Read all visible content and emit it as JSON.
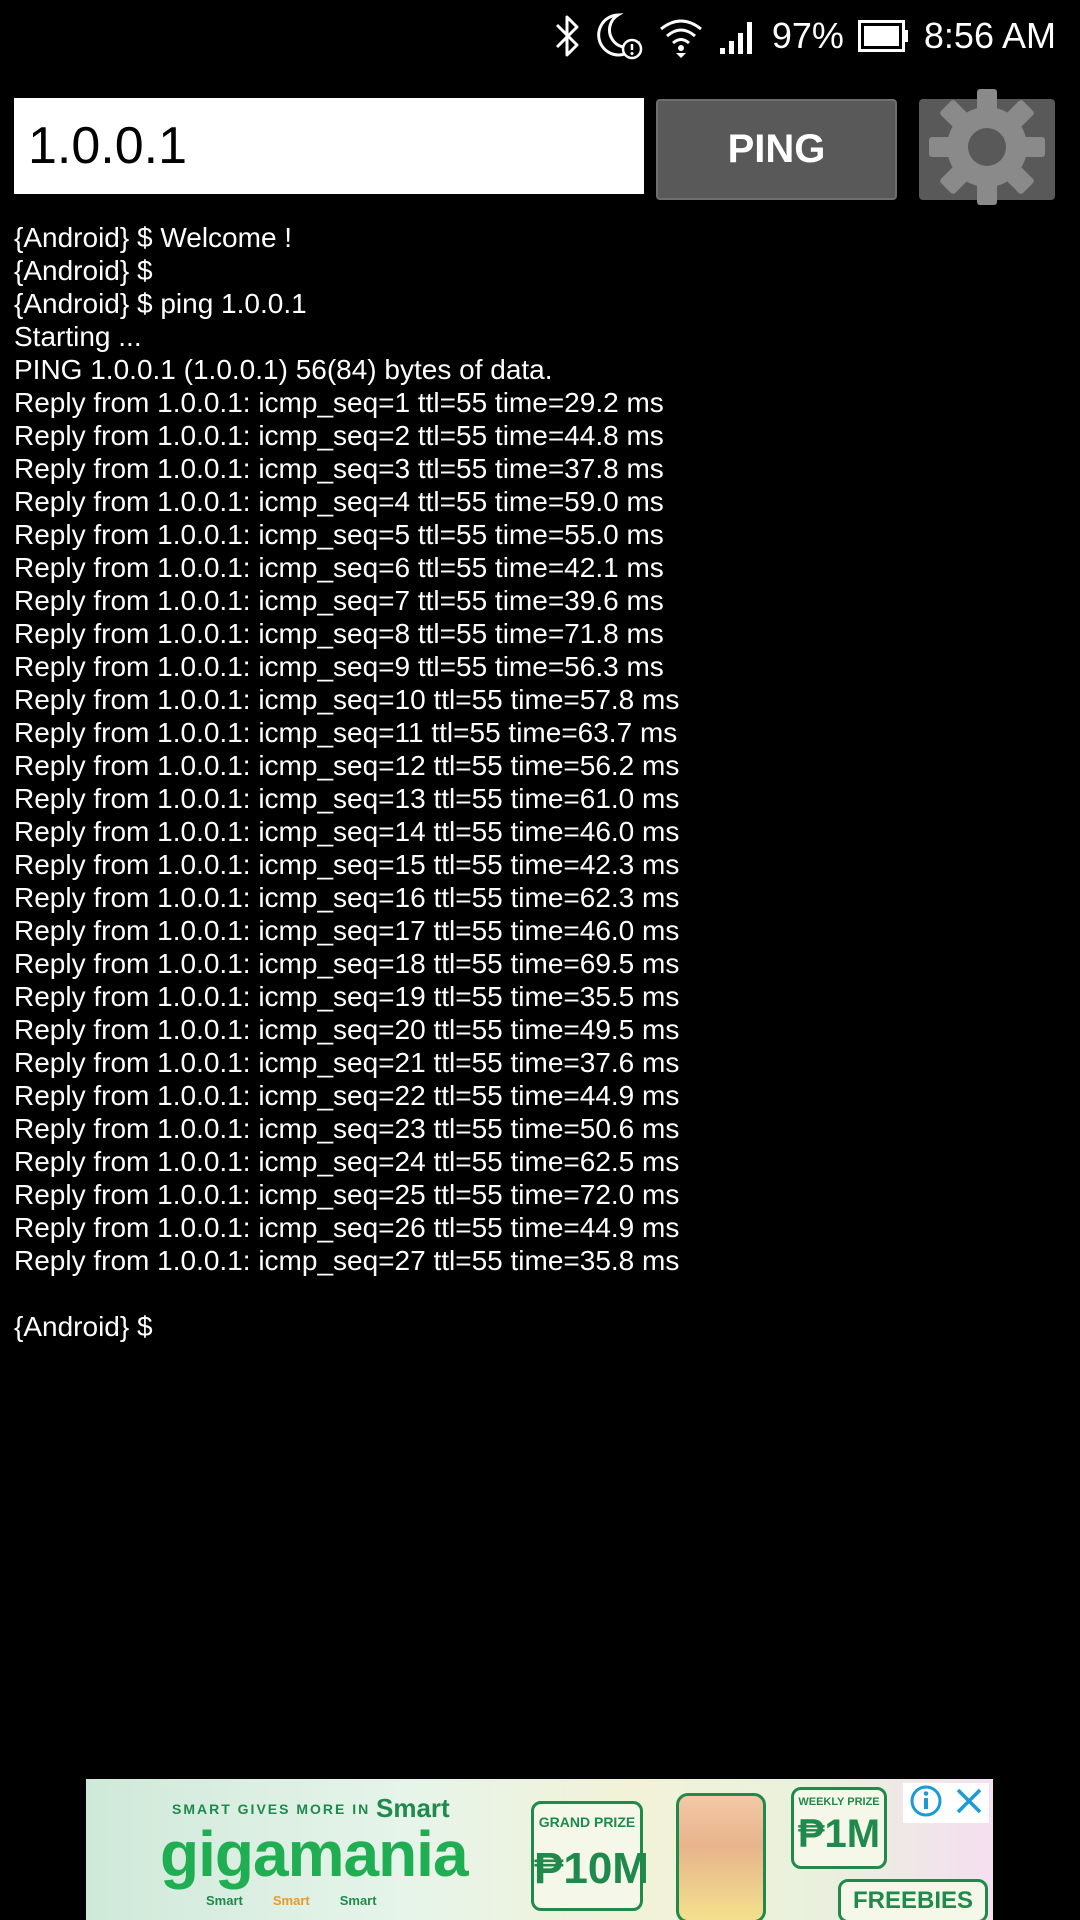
{
  "status_bar": {
    "battery_percent": "97%",
    "time": "8:56 AM",
    "icons": [
      "bluetooth-icon",
      "do-not-disturb-icon",
      "wifi-icon",
      "cellular-signal-icon",
      "battery-icon"
    ]
  },
  "toolbar": {
    "host_value": "1.0.0.1",
    "ping_label": "PING",
    "settings_icon": "gear-icon"
  },
  "console": {
    "lines": [
      "{Android} $ Welcome !",
      "{Android} $",
      "{Android} $ ping 1.0.0.1",
      "Starting ...",
      "PING 1.0.0.1 (1.0.0.1) 56(84) bytes of data.",
      "Reply from 1.0.0.1: icmp_seq=1 ttl=55 time=29.2 ms",
      "Reply from 1.0.0.1: icmp_seq=2 ttl=55 time=44.8 ms",
      "Reply from 1.0.0.1: icmp_seq=3 ttl=55 time=37.8 ms",
      "Reply from 1.0.0.1: icmp_seq=4 ttl=55 time=59.0 ms",
      "Reply from 1.0.0.1: icmp_seq=5 ttl=55 time=55.0 ms",
      "Reply from 1.0.0.1: icmp_seq=6 ttl=55 time=42.1 ms",
      "Reply from 1.0.0.1: icmp_seq=7 ttl=55 time=39.6 ms",
      "Reply from 1.0.0.1: icmp_seq=8 ttl=55 time=71.8 ms",
      "Reply from 1.0.0.1: icmp_seq=9 ttl=55 time=56.3 ms",
      "Reply from 1.0.0.1: icmp_seq=10 ttl=55 time=57.8 ms",
      "Reply from 1.0.0.1: icmp_seq=11 ttl=55 time=63.7 ms",
      "Reply from 1.0.0.1: icmp_seq=12 ttl=55 time=56.2 ms",
      "Reply from 1.0.0.1: icmp_seq=13 ttl=55 time=61.0 ms",
      "Reply from 1.0.0.1: icmp_seq=14 ttl=55 time=46.0 ms",
      "Reply from 1.0.0.1: icmp_seq=15 ttl=55 time=42.3 ms",
      "Reply from 1.0.0.1: icmp_seq=16 ttl=55 time=62.3 ms",
      "Reply from 1.0.0.1: icmp_seq=17 ttl=55 time=46.0 ms",
      "Reply from 1.0.0.1: icmp_seq=18 ttl=55 time=69.5 ms",
      "Reply from 1.0.0.1: icmp_seq=19 ttl=55 time=35.5 ms",
      "Reply from 1.0.0.1: icmp_seq=20 ttl=55 time=49.5 ms",
      "Reply from 1.0.0.1: icmp_seq=21 ttl=55 time=37.6 ms",
      "Reply from 1.0.0.1: icmp_seq=22 ttl=55 time=44.9 ms",
      "Reply from 1.0.0.1: icmp_seq=23 ttl=55 time=50.6 ms",
      "Reply from 1.0.0.1: icmp_seq=24 ttl=55 time=62.5 ms",
      "Reply from 1.0.0.1: icmp_seq=25 ttl=55 time=72.0 ms",
      "Reply from 1.0.0.1: icmp_seq=26 ttl=55 time=44.9 ms",
      "Reply from 1.0.0.1: icmp_seq=27 ttl=55 time=35.8 ms",
      "",
      "{Android} $"
    ]
  },
  "ad": {
    "tagline": "SMART GIVES MORE IN",
    "brand": "Smart",
    "title": "gigamania",
    "sub_brands": [
      "Smart",
      "Smart",
      "Smart"
    ],
    "grand_prize_label": "GRAND PRIZE",
    "grand_prize_amount": "₱10M",
    "weekly_label": "WEEKLY PRIZE",
    "weekly_amount": "₱1M",
    "freebies": "FREEBIES",
    "icons": [
      "ad-info-icon",
      "ad-close-icon"
    ]
  },
  "colors": {
    "background": "#000000",
    "console_text": "#ffffff",
    "button_gray": "#595959",
    "gear_gray": "#8a8a8a",
    "ad_green": "#1fae52"
  }
}
